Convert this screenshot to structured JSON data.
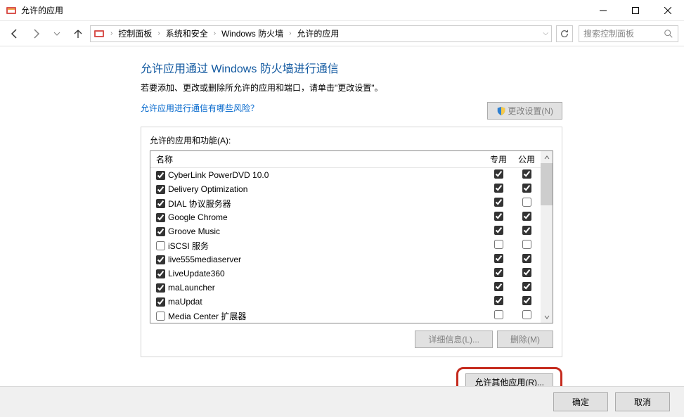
{
  "window": {
    "title": "允许的应用"
  },
  "breadcrumbs": [
    "控制面板",
    "系统和安全",
    "Windows 防火墙",
    "允许的应用"
  ],
  "search": {
    "placeholder": "搜索控制面板"
  },
  "page": {
    "title": "允许应用通过 Windows 防火墙进行通信",
    "desc": "若要添加、更改或删除所允许的应用和端口，请单击\"更改设置\"。",
    "risk_link": "允许应用进行通信有哪些风险？",
    "change_settings_btn": "更改设置(N)"
  },
  "group": {
    "label": "允许的应用和功能(A):",
    "col_name": "名称",
    "col_private": "专用",
    "col_public": "公用"
  },
  "apps": [
    {
      "name": "CyberLink PowerDVD 10.0",
      "enabled": true,
      "private": true,
      "public": true
    },
    {
      "name": "Delivery Optimization",
      "enabled": true,
      "private": true,
      "public": true
    },
    {
      "name": "DIAL 协议服务器",
      "enabled": true,
      "private": true,
      "public": false
    },
    {
      "name": "Google Chrome",
      "enabled": true,
      "private": true,
      "public": true
    },
    {
      "name": "Groove Music",
      "enabled": true,
      "private": true,
      "public": true
    },
    {
      "name": "iSCSI 服务",
      "enabled": false,
      "private": false,
      "public": false
    },
    {
      "name": "live555mediaserver",
      "enabled": true,
      "private": true,
      "public": true
    },
    {
      "name": "LiveUpdate360",
      "enabled": true,
      "private": true,
      "public": true
    },
    {
      "name": "maLauncher",
      "enabled": true,
      "private": true,
      "public": true
    },
    {
      "name": "maUpdat",
      "enabled": true,
      "private": true,
      "public": true
    },
    {
      "name": "Media Center 扩展器",
      "enabled": false,
      "private": false,
      "public": false
    }
  ],
  "buttons": {
    "details": "详细信息(L)...",
    "remove": "删除(M)",
    "allow_other": "允许其他应用(R)...",
    "ok": "确定",
    "cancel": "取消"
  }
}
